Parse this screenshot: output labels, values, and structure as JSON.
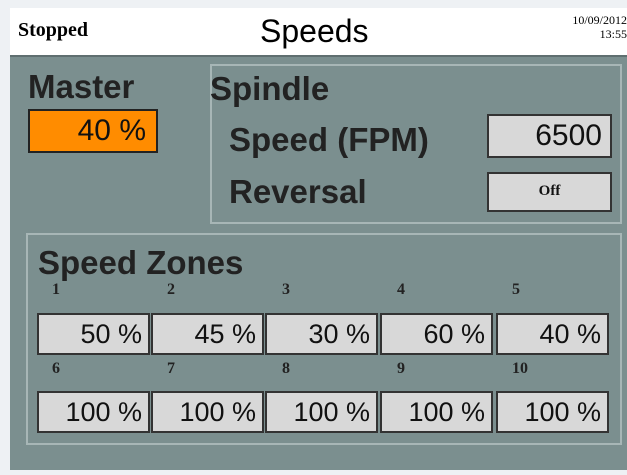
{
  "header": {
    "status": "Stopped",
    "title": "Speeds",
    "date": "10/09/2012",
    "time": "13:55"
  },
  "master": {
    "label": "Master",
    "value": "40 %"
  },
  "spindle": {
    "label": "Spindle",
    "speed_label": "Speed (FPM)",
    "speed_value": "6500",
    "reversal_label": "Reversal",
    "reversal_value": "Off"
  },
  "speed_zones": {
    "label": "Speed Zones",
    "zones": [
      {
        "num": "1",
        "value": "50 %"
      },
      {
        "num": "2",
        "value": "45 %"
      },
      {
        "num": "3",
        "value": "30 %"
      },
      {
        "num": "4",
        "value": "60 %"
      },
      {
        "num": "5",
        "value": "40 %"
      },
      {
        "num": "6",
        "value": "100 %"
      },
      {
        "num": "7",
        "value": "100 %"
      },
      {
        "num": "8",
        "value": "100 %"
      },
      {
        "num": "9",
        "value": "100 %"
      },
      {
        "num": "10",
        "value": "100 %"
      }
    ]
  },
  "colors": {
    "background": "#7b8f8f",
    "accent": "#ff8c00",
    "field": "#d8d8d8"
  }
}
